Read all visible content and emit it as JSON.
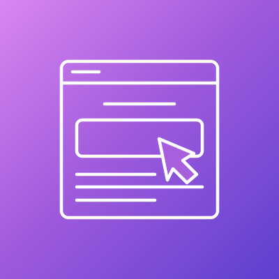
{
  "icon": {
    "name": "web-click-icon",
    "description_label": ""
  },
  "colors": {
    "gradient_start": "#d987f0",
    "gradient_mid": "#a25cdd",
    "gradient_end": "#5d3fcf",
    "stroke": "#ffffff"
  }
}
